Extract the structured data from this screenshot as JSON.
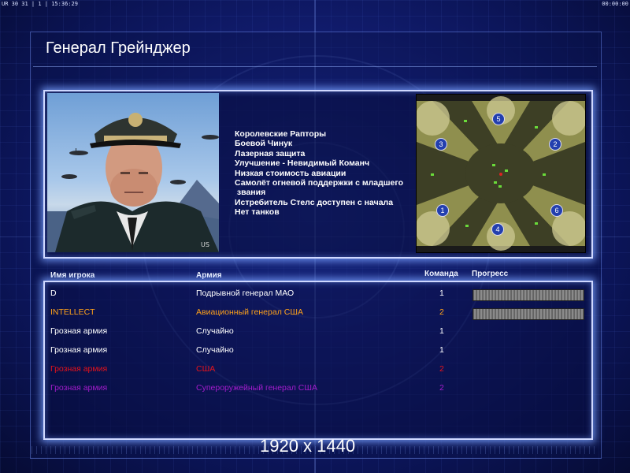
{
  "status_bar": {
    "left_text": "UR 30 31 | 1 | 15:36:29",
    "right_text": "00:00:00"
  },
  "general": {
    "name": "Генерал Грейнджер",
    "traits": [
      "Королевские Рапторы",
      "Боевой Чинук",
      "Лазерная защита",
      "Улучшение - Невидимый Команч",
      "Низкая стоимость авиации",
      "Самолёт огневой поддержки с младшего",
      " звания",
      "Истребитель Стелс доступен с начала",
      "Нет танков"
    ]
  },
  "map": {
    "start_positions": [
      "1",
      "2",
      "3",
      "4",
      "5",
      "6"
    ]
  },
  "table": {
    "headers": {
      "player": "Имя игрока",
      "army": "Армия",
      "team": "Команда",
      "progress": "Прогресс"
    },
    "rows": [
      {
        "player": "D",
        "army": "Подрывной генерал МАО",
        "team": "1",
        "color": "#ffffff",
        "progress": 1.0
      },
      {
        "player": "INTELLECT",
        "army": "Авиационный генерал США",
        "team": "2",
        "color": "#ffa21a",
        "progress": 1.0
      },
      {
        "player": "Грозная армия",
        "army": "Случайно",
        "team": "1",
        "color": "#ffffff",
        "progress": null
      },
      {
        "player": "Грозная армия",
        "army": "Случайно",
        "team": "1",
        "color": "#ffffff",
        "progress": null
      },
      {
        "player": "Грозная армия",
        "army": "США",
        "team": "2",
        "color": "#e8121a",
        "progress": null
      },
      {
        "player": "Грозная армия",
        "army": "Супероружейный генерал США",
        "team": "2",
        "color": "#a41ccc",
        "progress": null
      }
    ]
  },
  "resolution_label": "1920 x 1440"
}
